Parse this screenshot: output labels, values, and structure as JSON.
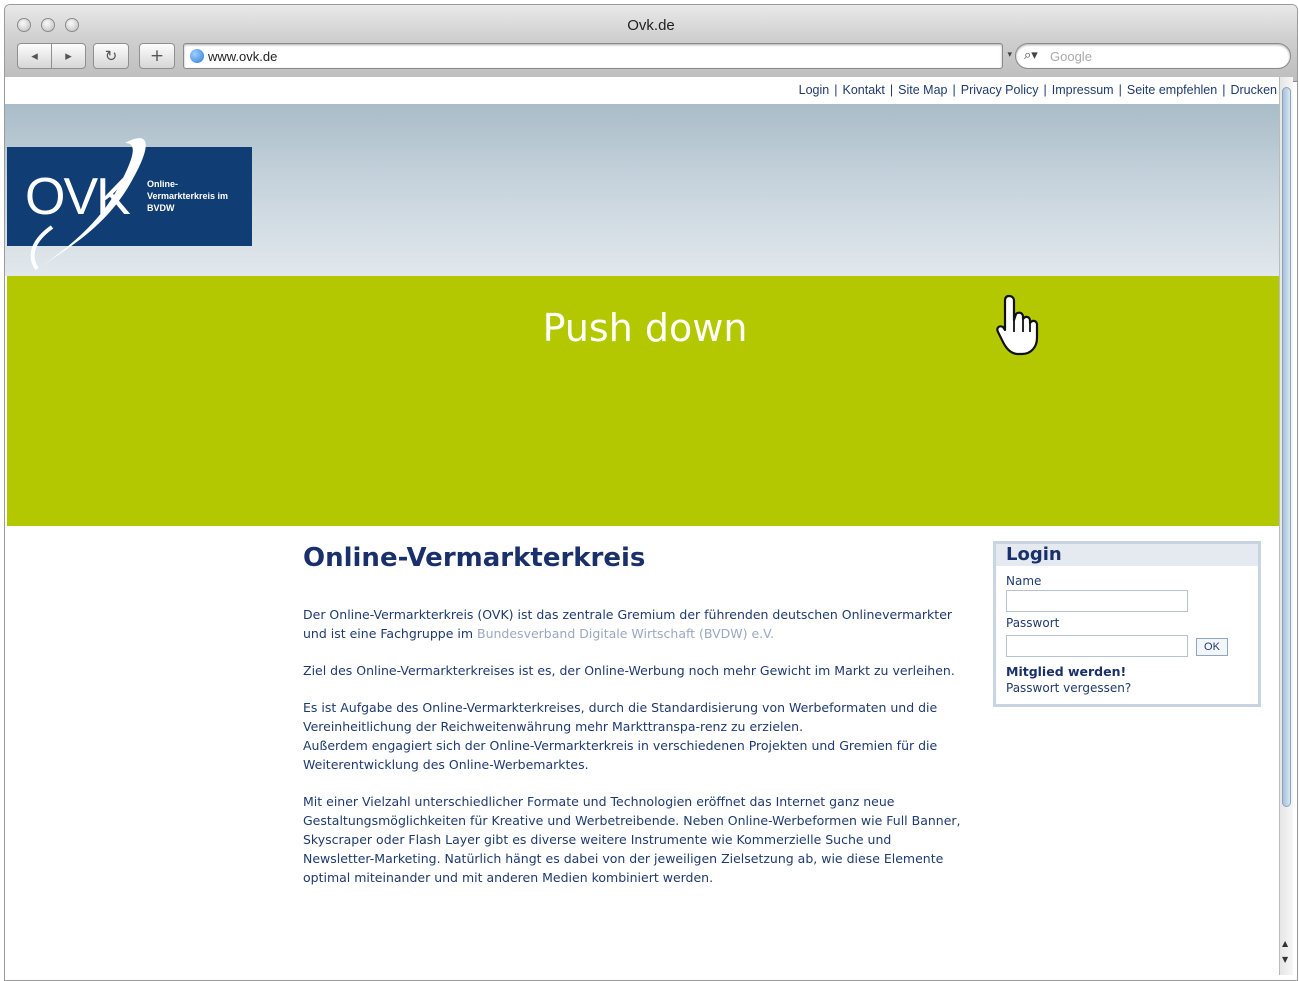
{
  "browser": {
    "window_title": "Ovk.de",
    "url": "www.ovk.de",
    "search_placeholder": "Google",
    "back_icon": "◂",
    "forward_icon": "▸",
    "reload_icon": "↻",
    "add_bookmark_icon": "+"
  },
  "top_links": [
    "Login",
    "Kontakt",
    "Site Map",
    "Privacy Policy",
    "Impressum",
    "Seite empfehlen",
    "Drucken"
  ],
  "logo": {
    "wordmark": "OVK",
    "subtitle": "Online-Vermarkterkreis im BVDW"
  },
  "pushdown": {
    "text": "Push down",
    "color": "#b4c800"
  },
  "content": {
    "title": "Online-Vermarkterkreis",
    "p1_text": "Der Online-Vermarkterkreis (OVK) ist das zentrale Gremium der führenden deutschen Onlinevermarkter und ist eine Fachgruppe im ",
    "p1_link": "Bundesverband Digitale Wirtschaft (BVDW) e.V.",
    "p2": "Ziel des Online-Vermarkterkreises ist es, der Online-Werbung noch mehr Gewicht im Markt zu verleihen.",
    "p3": "Es ist Aufgabe des Online-Vermarkterkreises, durch die Standardisierung von Werbeformaten und die Vereinheitlichung der Reichweitenwährung mehr Markttranspa-renz zu erzielen.",
    "p3b": "Außerdem engagiert sich der Online-Vermarkterkreis in verschiedenen Projekten und Gremien für die Weiterentwicklung des Online-Werbemarktes.",
    "p4": "Mit einer Vielzahl unterschiedlicher Formate und Technologien eröffnet das Internet ganz neue Gestaltungsmöglichkeiten für Kreative und Werbetreibende. Neben Online-Werbeformen wie Full Banner, Skyscraper oder Flash Layer gibt es diverse weitere Instrumente wie Kommerzielle Suche und Newsletter-Marketing. Natürlich hängt es dabei von der jeweiligen Zielsetzung ab, wie diese Elemente optimal miteinander und mit anderen Medien kombiniert werden."
  },
  "login": {
    "title": "Login",
    "name_label": "Name",
    "password_label": "Passwort",
    "ok_label": "OK",
    "member_link": "Mitglied werden!",
    "forgot_link": "Passwort vergessen?"
  },
  "colors": {
    "brand_navy": "#103d74",
    "text_navy": "#19306b",
    "link_muted": "#9aa8c2"
  }
}
